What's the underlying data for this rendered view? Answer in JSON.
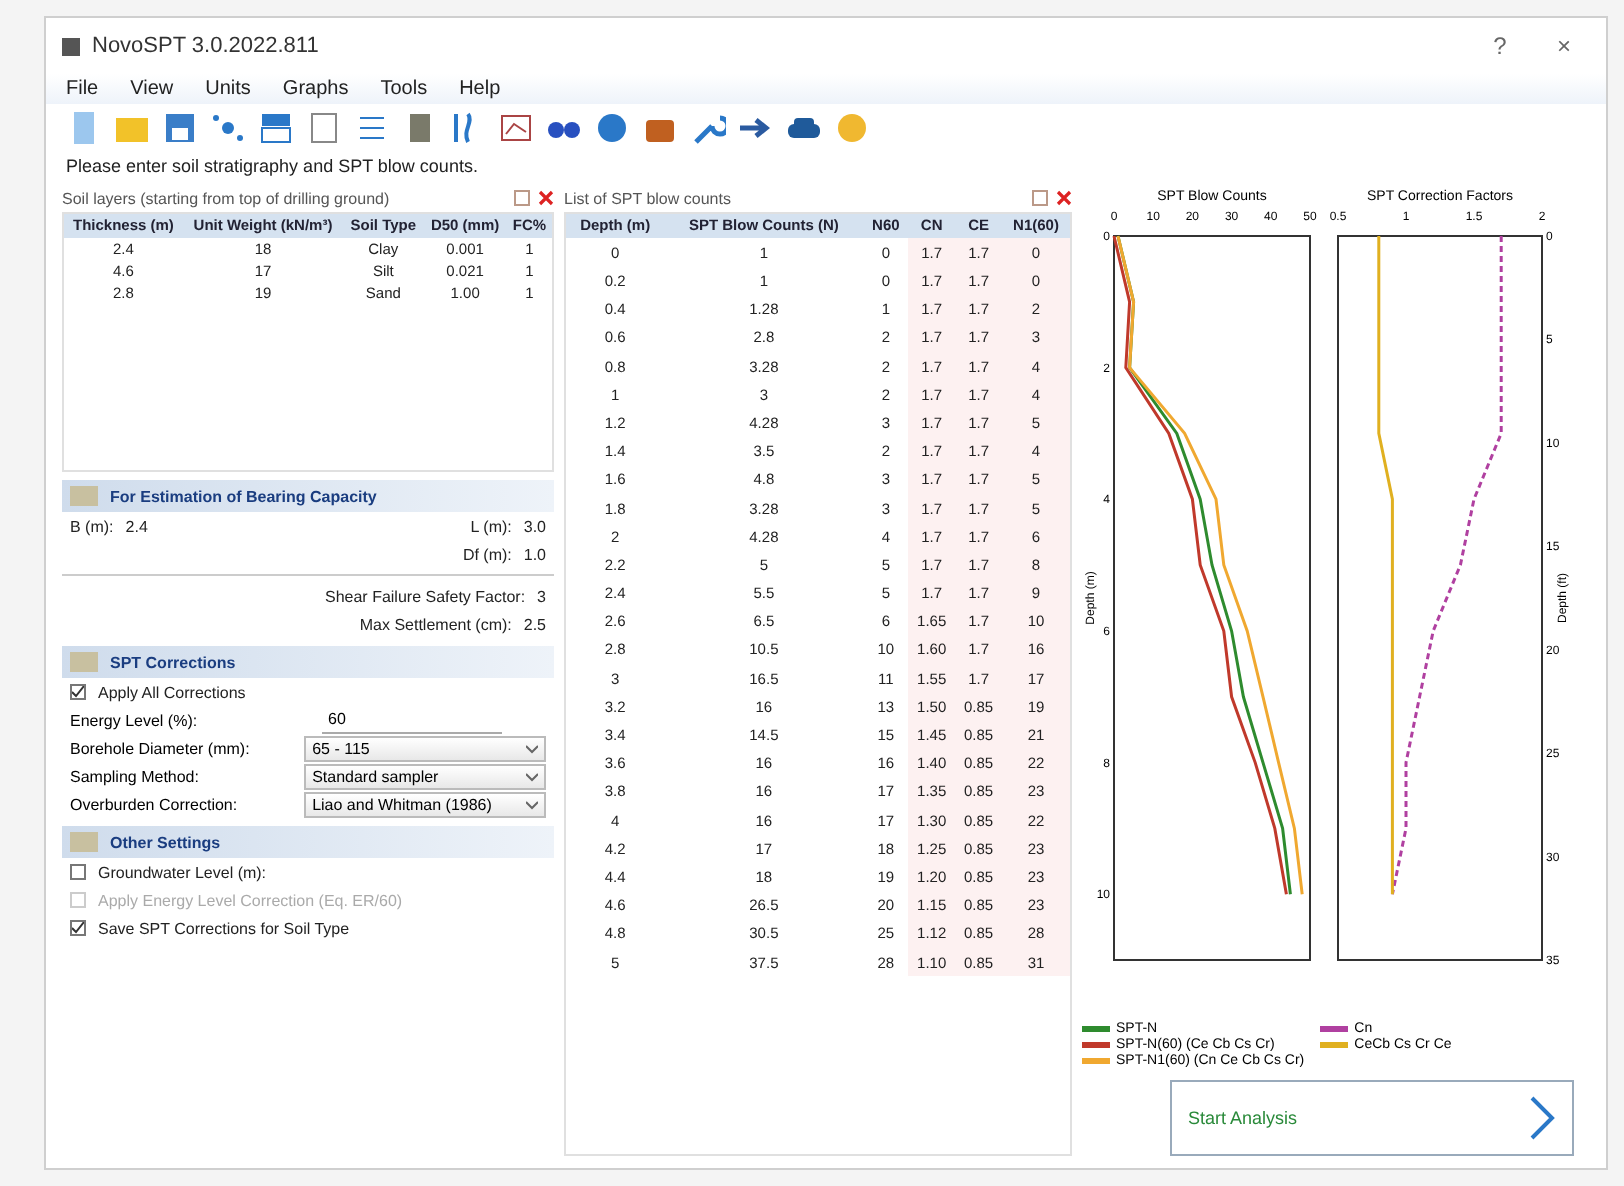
{
  "window": {
    "title": "NovoSPT 3.0.2022.811",
    "controls": [
      "?",
      "×"
    ]
  },
  "menu": [
    "File",
    "View",
    "Units",
    "Graphs",
    "Tools",
    "Help"
  ],
  "instruction": "Please enter soil stratigraphy and SPT blow counts.",
  "layers": {
    "title": "Soil layers (starting from top of drilling ground)",
    "columns": [
      "Thickness (m)",
      "Unit Weight (kN/m³)",
      "Soil Type",
      "D50 (mm)",
      "FC%"
    ],
    "rows": [
      [
        "2.4",
        "18",
        "Clay",
        "0.001",
        "1"
      ],
      [
        "4.6",
        "17",
        "Silt",
        "0.021",
        "1"
      ],
      [
        "2.8",
        "19",
        "Sand",
        "1.00",
        "1"
      ]
    ]
  },
  "bearing": {
    "title": "For Estimation of Bearing Capacity",
    "b_label": "B (m):",
    "b_value": "2.4",
    "l_label": "L (m):",
    "l_value": "3.0",
    "d_label": "Df (m):",
    "d_value": "1.0",
    "sf_label": "Shear Failure Safety Factor:",
    "sf_value": "3",
    "settle_label": "Max Settlement (cm):",
    "settle_value": "2.5"
  },
  "corrections": {
    "title": "SPT Corrections",
    "apply_label": "Apply All Corrections",
    "apply_checked": true,
    "fields": [
      {
        "label": "Energy Level (%):",
        "value": "60",
        "kind": "input"
      },
      {
        "label": "Borehole Diameter (mm):",
        "value": "65 - 115",
        "kind": "select"
      },
      {
        "label": "Sampling Method:",
        "value": "Standard sampler",
        "kind": "select"
      },
      {
        "label": "Overburden Correction:",
        "value": "Liao and Whitman (1986)",
        "kind": "select"
      }
    ]
  },
  "other": {
    "title": "Other Settings",
    "items": [
      {
        "label": "Groundwater Level (m):",
        "checked": false,
        "disabled": false
      },
      {
        "label": "Apply Energy Level Correction (Eq. ER/60)",
        "checked": false,
        "disabled": true
      },
      {
        "label": "Save SPT Corrections for Soil Type",
        "checked": true,
        "disabled": false
      }
    ]
  },
  "blows": {
    "title": "List of SPT blow counts",
    "columns": [
      "Depth (m)",
      "SPT Blow Counts (N)",
      "N60",
      "CN",
      "CE",
      "N1(60)"
    ],
    "rows": [
      [
        "0",
        "1",
        "0",
        "1.7",
        "1.7",
        "0"
      ],
      [
        "0.2",
        "1",
        "0",
        "1.7",
        "1.7",
        "0"
      ],
      [
        "0.4",
        "1.28",
        "1",
        "1.7",
        "1.7",
        "2"
      ],
      [
        "0.6",
        "2.8",
        "2",
        "1.7",
        "1.7",
        "3"
      ],
      [
        "0.8",
        "3.28",
        "2",
        "1.7",
        "1.7",
        "4"
      ],
      [
        "1",
        "3",
        "2",
        "1.7",
        "1.7",
        "4"
      ],
      [
        "1.2",
        "4.28",
        "3",
        "1.7",
        "1.7",
        "5"
      ],
      [
        "1.4",
        "3.5",
        "2",
        "1.7",
        "1.7",
        "4"
      ],
      [
        "1.6",
        "4.8",
        "3",
        "1.7",
        "1.7",
        "5"
      ],
      [
        "1.8",
        "3.28",
        "3",
        "1.7",
        "1.7",
        "5"
      ],
      [
        "2",
        "4.28",
        "4",
        "1.7",
        "1.7",
        "6"
      ],
      [
        "2.2",
        "5",
        "5",
        "1.7",
        "1.7",
        "8"
      ],
      [
        "2.4",
        "5.5",
        "5",
        "1.7",
        "1.7",
        "9"
      ],
      [
        "2.6",
        "6.5",
        "6",
        "1.65",
        "1.7",
        "10"
      ],
      [
        "2.8",
        "10.5",
        "10",
        "1.60",
        "1.7",
        "16"
      ],
      [
        "3",
        "16.5",
        "11",
        "1.55",
        "1.7",
        "17"
      ],
      [
        "3.2",
        "16",
        "13",
        "1.50",
        "0.85",
        "19"
      ],
      [
        "3.4",
        "14.5",
        "15",
        "1.45",
        "0.85",
        "21"
      ],
      [
        "3.6",
        "16",
        "16",
        "1.40",
        "0.85",
        "22"
      ],
      [
        "3.8",
        "16",
        "17",
        "1.35",
        "0.85",
        "23"
      ],
      [
        "4",
        "16",
        "17",
        "1.30",
        "0.85",
        "22"
      ],
      [
        "4.2",
        "17",
        "18",
        "1.25",
        "0.85",
        "23"
      ],
      [
        "4.4",
        "18",
        "19",
        "1.20",
        "0.85",
        "23"
      ],
      [
        "4.6",
        "26.5",
        "20",
        "1.15",
        "0.85",
        "23"
      ],
      [
        "4.8",
        "30.5",
        "25",
        "1.12",
        "0.85",
        "28"
      ],
      [
        "5",
        "37.5",
        "28",
        "1.10",
        "0.85",
        "31"
      ]
    ]
  },
  "chart_blows": {
    "title": "SPT Blow Counts",
    "axis_label": "Depth (m)",
    "top_ticks": [
      "0",
      "10",
      "20",
      "30",
      "40",
      "50"
    ],
    "side_ticks": [
      "0",
      "2",
      "4",
      "6",
      "8",
      "10"
    ],
    "legend": [
      {
        "label": "SPT-N",
        "color": "#2e8b2e"
      },
      {
        "label": "SPT-N(60) (Ce Cb Cs Cr)",
        "color": "#c0392b"
      },
      {
        "label": "SPT-N1(60) (Cn Ce Cb Cs Cr)",
        "color": "#f0a830"
      }
    ]
  },
  "chart_factors": {
    "title": "SPT Correction Factors",
    "axis_label": "Depth (ft)",
    "top_ticks": [
      "0.5",
      "1",
      "1.5",
      "2"
    ],
    "side_ticks": [
      "0",
      "5",
      "10",
      "15",
      "20",
      "25",
      "30",
      "35"
    ],
    "legend": [
      {
        "label": "Cn",
        "color": "#b040a0"
      },
      {
        "label": "CeCb Cs Cr Ce",
        "color": "#e0b020"
      }
    ]
  },
  "start_button": "Start Analysis"
}
